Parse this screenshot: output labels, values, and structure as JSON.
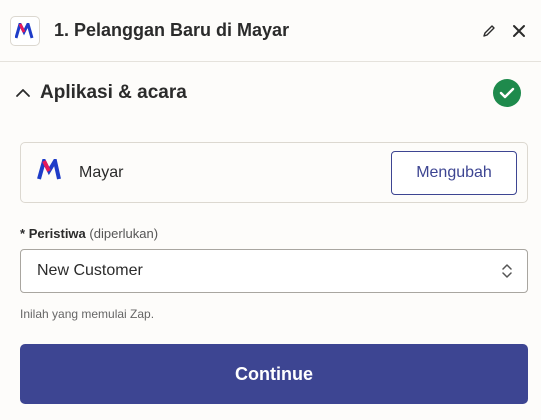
{
  "header": {
    "step_title": "1. Pelanggan Baru di Mayar",
    "app_icon": "mayar-logo-icon",
    "edit_icon": "pencil-icon",
    "close_icon": "close-icon"
  },
  "section": {
    "title": "Aplikasi & acara",
    "collapse_icon": "chevron-up-icon",
    "status_icon": "checkmark-circle-icon",
    "status_color": "#1e8a4c"
  },
  "app_card": {
    "app_name": "Mayar",
    "change_label": "Mengubah"
  },
  "event_field": {
    "required_marker": "*",
    "label": "Peristiwa",
    "required_note": "(diperlukan)",
    "value": "New Customer",
    "help": "Inilah yang memulai Zap."
  },
  "footer": {
    "continue_label": "Continue"
  },
  "colors": {
    "accent": "#3d4592",
    "logo_pink": "#e8195a",
    "logo_blue": "#1e3cc8"
  }
}
